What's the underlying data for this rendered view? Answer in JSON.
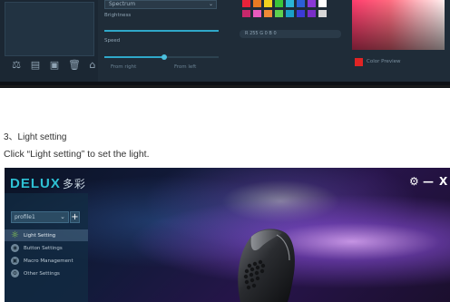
{
  "fig1": {
    "mode_dropdown": {
      "value": "Spectrum",
      "caret": "⌄"
    },
    "brightness_label": "Brightness",
    "brightness_value": 1.0,
    "speed_label": "Speed",
    "speed_value": 0.52,
    "mid_bottom_left": "From right",
    "mid_bottom_right": "From left",
    "rgb_readout": "R  255  G  0    B  0",
    "current_color_text": "Color Preview",
    "toolbar_icons": [
      "scale-icon",
      "document-icon",
      "page-icon",
      "trash-icon",
      "home-icon"
    ],
    "toolbar_glyphs": [
      "⚖",
      "▤",
      "▣",
      "🗑",
      "⌂"
    ],
    "swatch_colors": [
      "#e8233a",
      "#e87a23",
      "#f2d21e",
      "#3ac43a",
      "#2ab5d6",
      "#2b5fd6",
      "#8a38d6",
      "#ffffff",
      "#c8286b",
      "#e85bbf",
      "#f08a36",
      "#5fd14f",
      "#1aa0c8",
      "#3b3bd6",
      "#7a2ec8",
      "#d8d8d8"
    ],
    "current_color": "#e02424"
  },
  "doc": {
    "section_title": "3、Light setting",
    "instruction": "Click “Light setting” to set the light."
  },
  "fig2": {
    "logo": "DELUX",
    "logo_cn": "多彩",
    "window_controls": {
      "settings": "⚙",
      "minimize": "—",
      "close": "X"
    },
    "profile": {
      "value": "profile1",
      "caret": "⌄",
      "add": "+"
    },
    "menu": [
      {
        "label": "Light Setting",
        "icon": "light-icon",
        "glyph": "☼",
        "active": true
      },
      {
        "label": "Button Settings",
        "icon": "button-icon",
        "glyph": "◉",
        "active": false
      },
      {
        "label": "Macro Management",
        "icon": "macro-icon",
        "glyph": "▣",
        "active": false
      },
      {
        "label": "Other Settings",
        "icon": "other-settings-icon",
        "glyph": "⚙",
        "active": false
      }
    ]
  }
}
